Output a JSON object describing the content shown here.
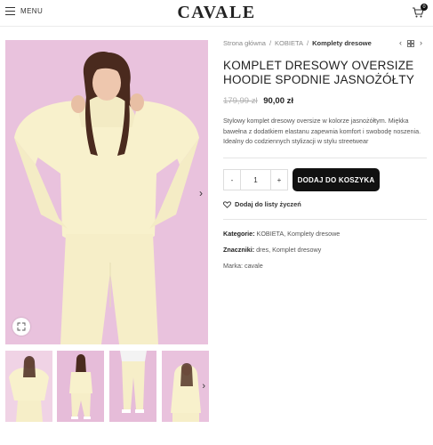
{
  "header": {
    "menu_label": "MENU",
    "logo": "CAVALE",
    "cart_count": "0"
  },
  "breadcrumb": {
    "items": [
      "Strona główna",
      "/",
      "KOBIETA",
      "/",
      "Komplety dresowe"
    ]
  },
  "product": {
    "title": "KOMPLET DRESOWY OVERSIZE HOODIE SPODNIE JASNOŻÓŁTY",
    "price_old": "179,99 zł",
    "price_new": "90,00 zł",
    "description": "Stylowy komplet dresowy oversize w kolorze jasnożółtym. Miękka bawełna z dodatkiem elastanu zapewnia komfort i swobodę noszenia. Idealny do codziennych stylizacji w stylu streetwear",
    "quantity": "1",
    "minus_label": "-",
    "plus_label": "+",
    "add_to_cart": "DODAJ DO KOSZYKA",
    "wishlist": "Dodaj do listy życzeń",
    "categories_label": "Kategorie:",
    "categories": [
      "KOBIETA",
      "Komplety dresowe"
    ],
    "tags_label": "Znaczniki:",
    "tags": [
      "dres",
      "Komplet dresowy"
    ],
    "brand_label": "Marka:",
    "brand": "cavale"
  },
  "colors": {
    "background_pink": "#e9c2dd",
    "outfit_yellow": "#f8f1cc",
    "button_black": "#111111"
  },
  "icons": [
    "hamburger-icon",
    "cart-icon",
    "chevron-left-icon",
    "grid-icon",
    "chevron-right-icon",
    "zoom-icon",
    "heart-icon"
  ]
}
